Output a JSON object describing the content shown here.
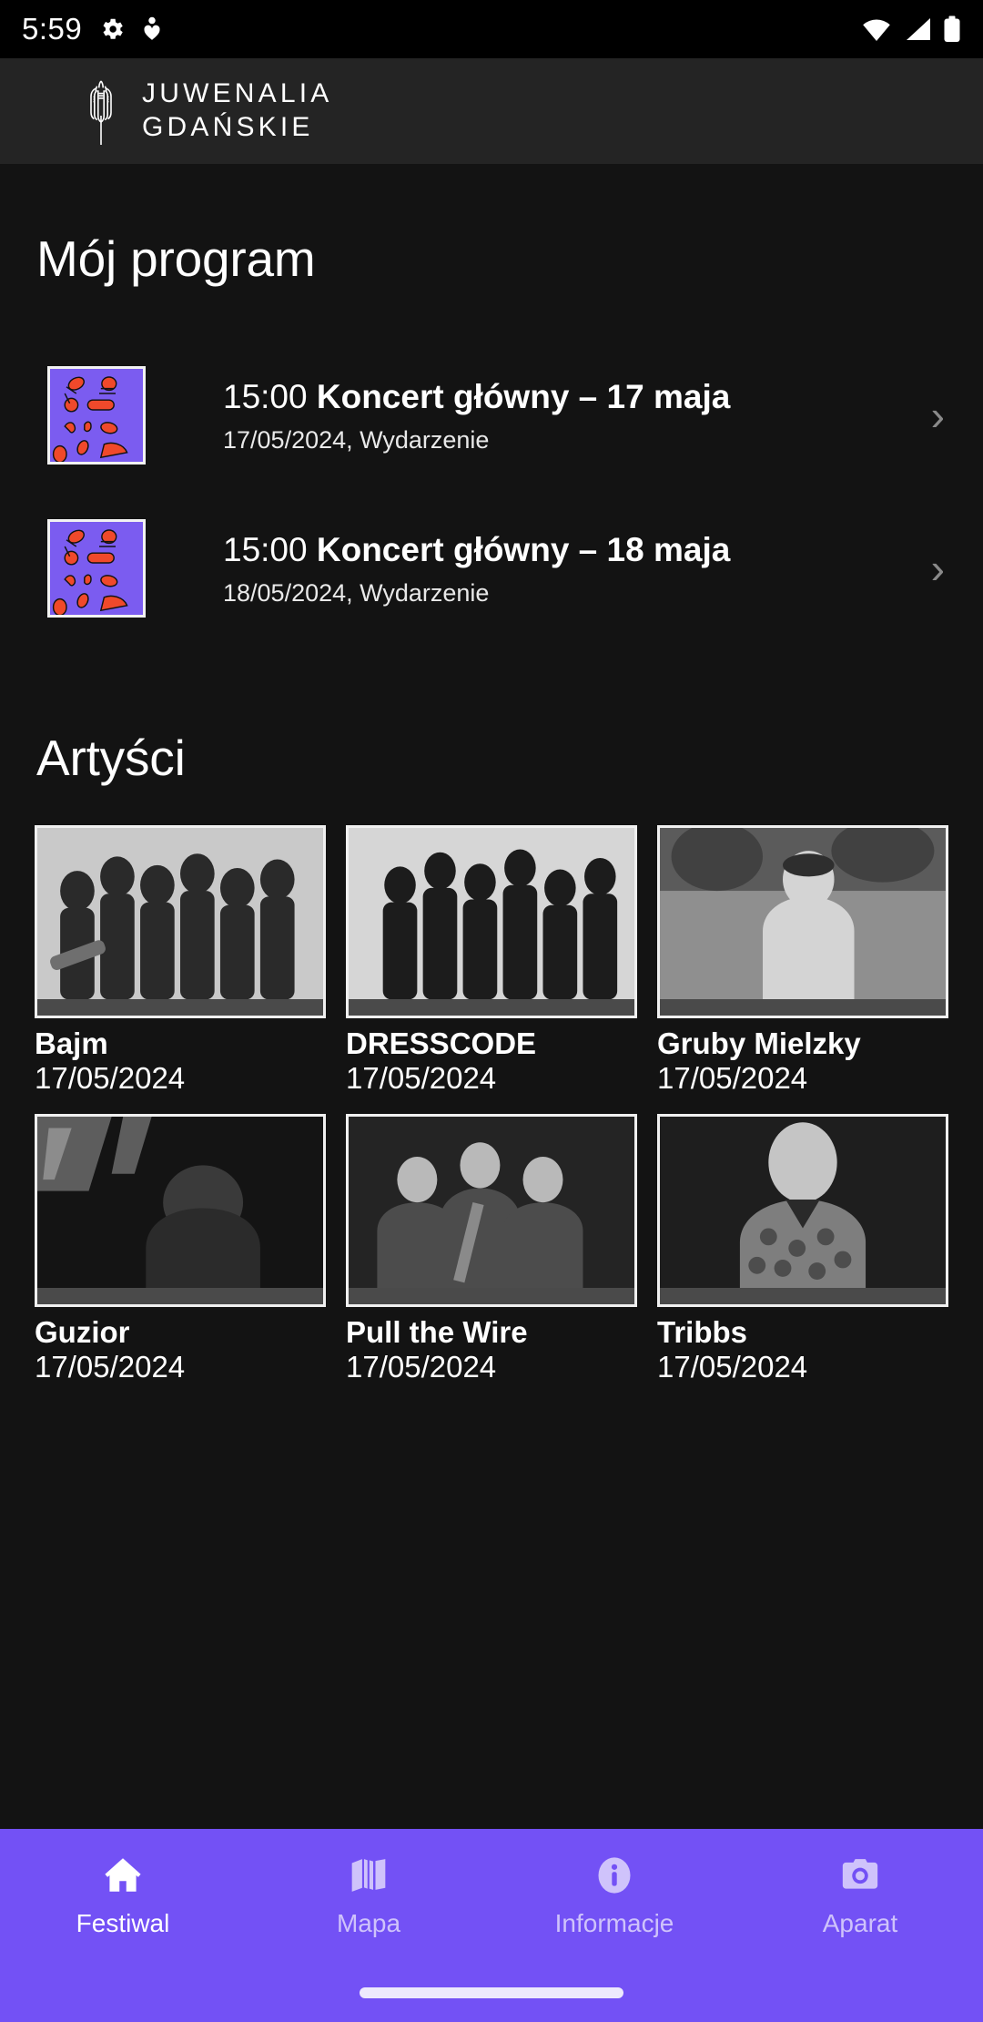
{
  "statusbar": {
    "time": "5:59",
    "icons_left": [
      "gear-icon",
      "person-icon"
    ],
    "icons_right": [
      "wifi-icon",
      "signal-icon",
      "battery-icon"
    ]
  },
  "header": {
    "logo_icon": "tulip-logo-icon",
    "title_line1": "JUWENALIA",
    "title_line2": "GDAŃSKIE"
  },
  "my_program": {
    "heading": "Mój program",
    "items": [
      {
        "time": "15:00",
        "title": "Koncert główny – 17 maja",
        "subtitle": "17/05/2024, Wydarzenie",
        "chevron": "›"
      },
      {
        "time": "15:00",
        "title": "Koncert główny – 18 maja",
        "subtitle": "18/05/2024, Wydarzenie",
        "chevron": "›"
      }
    ]
  },
  "artists": {
    "heading": "Artyści",
    "items": [
      {
        "name": "Bajm",
        "date": "17/05/2024"
      },
      {
        "name": "DRESSCODE",
        "date": "17/05/2024"
      },
      {
        "name": "Gruby Mielzky",
        "date": "17/05/2024"
      },
      {
        "name": "Guzior",
        "date": "17/05/2024"
      },
      {
        "name": "Pull the Wire",
        "date": "17/05/2024"
      },
      {
        "name": "Tribbs",
        "date": "17/05/2024"
      }
    ]
  },
  "bottom_nav": {
    "items": [
      {
        "label": "Festiwal",
        "icon": "home-icon",
        "active": true
      },
      {
        "label": "Mapa",
        "icon": "map-icon",
        "active": false
      },
      {
        "label": "Informacje",
        "icon": "info-icon",
        "active": false
      },
      {
        "label": "Aparat",
        "icon": "camera-icon",
        "active": false
      }
    ]
  },
  "colors": {
    "accent_purple": "#7351F5",
    "thumb_purple": "#7B5CF0",
    "thumb_doodle_red": "#F0492B",
    "header_bg": "#242424",
    "body_bg": "#131313",
    "statusbar_bg": "#000000"
  }
}
